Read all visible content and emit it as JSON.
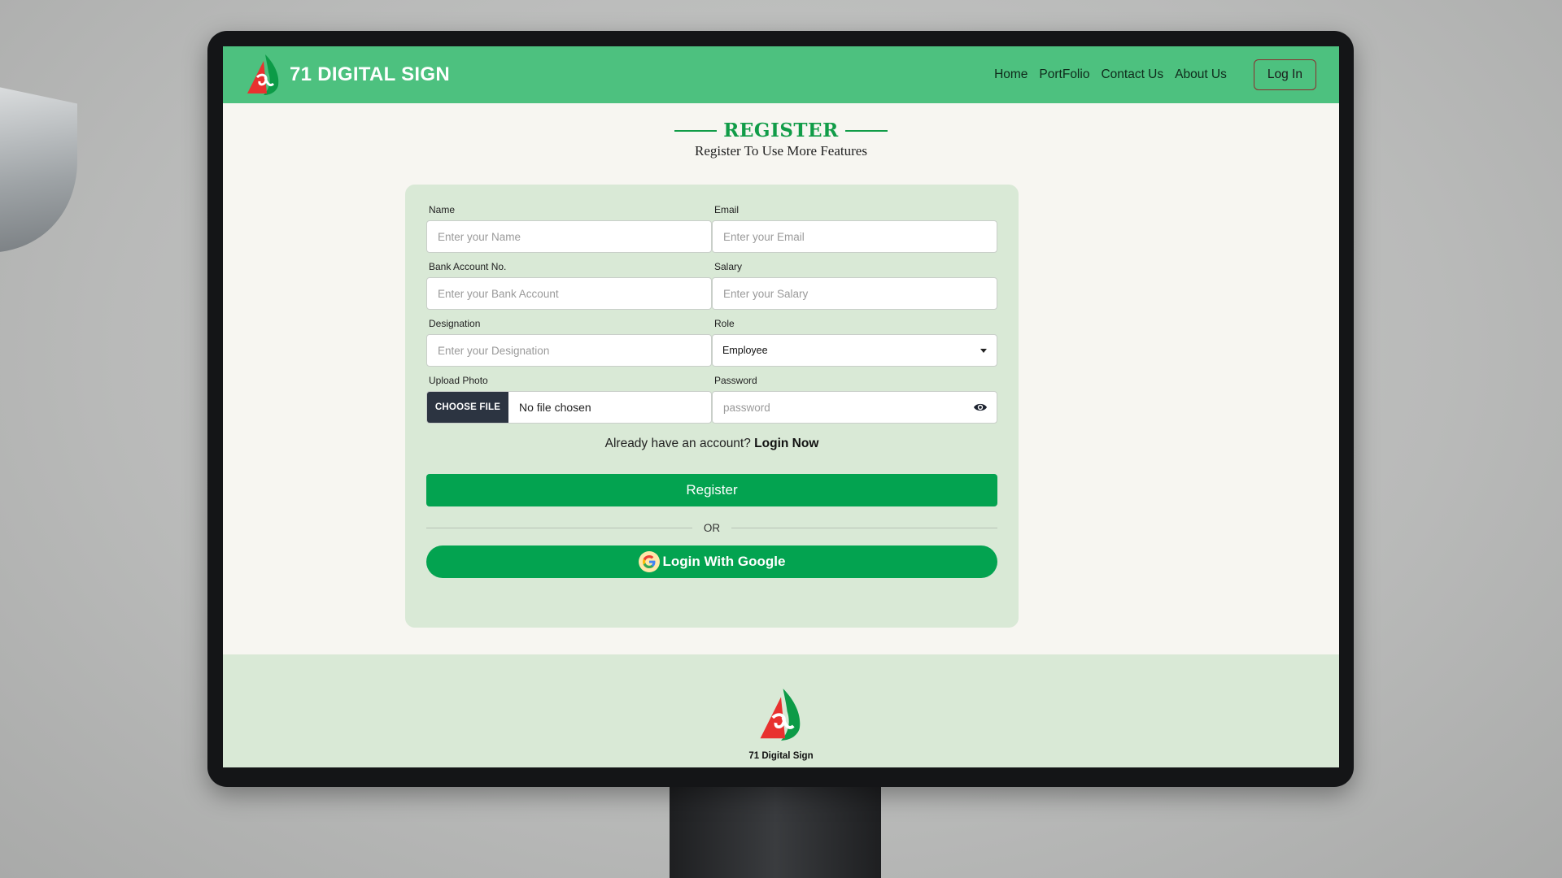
{
  "header": {
    "brand": "71 DIGITAL SIGN",
    "nav": [
      "Home",
      "PortFolio",
      "Contact Us",
      "About Us"
    ],
    "login_label": "Log In"
  },
  "page": {
    "title": "REGISTER",
    "subtitle": "Register To Use More Features"
  },
  "form": {
    "name": {
      "label": "Name",
      "placeholder": "Enter your Name"
    },
    "email": {
      "label": "Email",
      "placeholder": "Enter your Email"
    },
    "bank": {
      "label": "Bank Account No.",
      "placeholder": "Enter your Bank Account"
    },
    "salary": {
      "label": "Salary",
      "placeholder": "Enter your Salary"
    },
    "designation": {
      "label": "Designation",
      "placeholder": "Enter your Designation"
    },
    "role": {
      "label": "Role",
      "value": "Employee"
    },
    "photo": {
      "label": "Upload Photo",
      "button": "CHOOSE FILE",
      "status": "No file chosen"
    },
    "password": {
      "label": "Password",
      "placeholder": "password"
    },
    "already_text": "Already have an account?",
    "login_now": "Login Now",
    "register_label": "Register",
    "or_label": "OR",
    "google_label": "Login With Google"
  },
  "footer": {
    "name": "71 Digital Sign"
  },
  "colors": {
    "brand_green": "#4dc17f",
    "button_green": "#03a350",
    "card_bg": "#d9e9d6",
    "accent_red": "#e8312f"
  },
  "icons": [
    "logo-icon",
    "eye-icon",
    "google-icon",
    "dropdown-caret-icon"
  ]
}
